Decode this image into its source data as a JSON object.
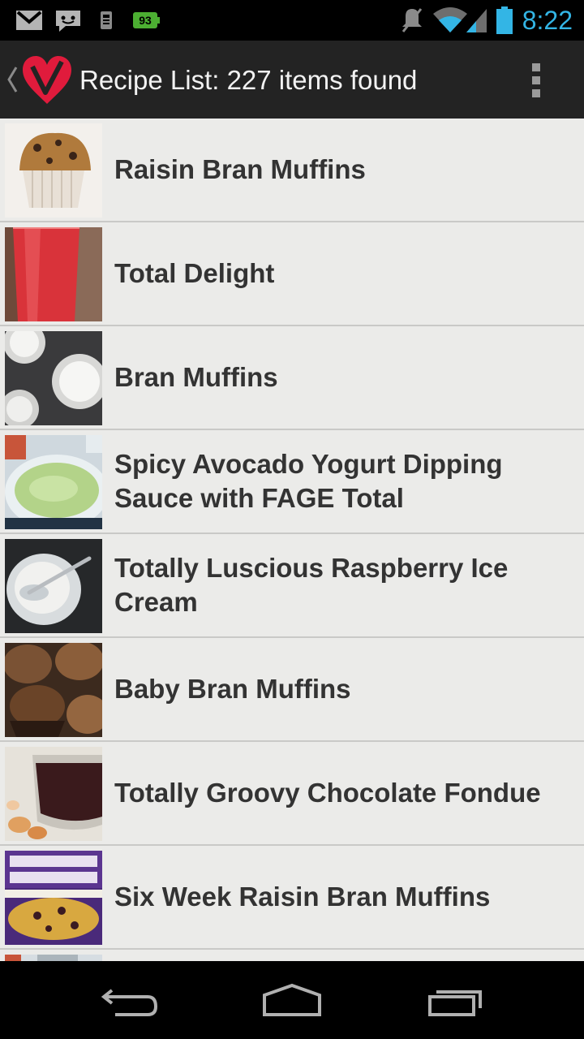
{
  "status_bar": {
    "time": "8:22",
    "battery_percent_label": "93",
    "accent_color": "#33b5e5",
    "icons": [
      "gmail-icon",
      "messaging-icon",
      "sd-card-icon",
      "battery-saver-icon",
      "mute-icon",
      "wifi-icon",
      "signal-icon",
      "battery-icon"
    ]
  },
  "action_bar": {
    "title": "Recipe List: 227 items found",
    "logo": "heart-v-logo",
    "overflow_icon": "more-vert-icon",
    "brand_color": "#e01b3c"
  },
  "recipes": [
    {
      "title": "Raisin Bran Muffins",
      "thumbnail": "muffin-photo"
    },
    {
      "title": "Total Delight",
      "thumbnail": "red-smoothie-photo"
    },
    {
      "title": "Bran Muffins",
      "thumbnail": "muffin-tin-photo"
    },
    {
      "title": "Spicy Avocado Yogurt Dipping Sauce with FAGE Total",
      "thumbnail": "avocado-dip-photo"
    },
    {
      "title": "Totally Luscious Raspberry Ice Cream",
      "thumbnail": "ice-cream-bowl-photo"
    },
    {
      "title": "Baby Bran Muffins",
      "thumbnail": "baby-muffins-photo"
    },
    {
      "title": "Totally Groovy Chocolate Fondue",
      "thumbnail": "chocolate-fondue-photo"
    },
    {
      "title": "Six Week Raisin Bran Muffins",
      "thumbnail": "raisin-bran-box-photo"
    }
  ],
  "nav_bar": {
    "icons": [
      "back-icon",
      "home-icon",
      "recent-apps-icon"
    ]
  }
}
